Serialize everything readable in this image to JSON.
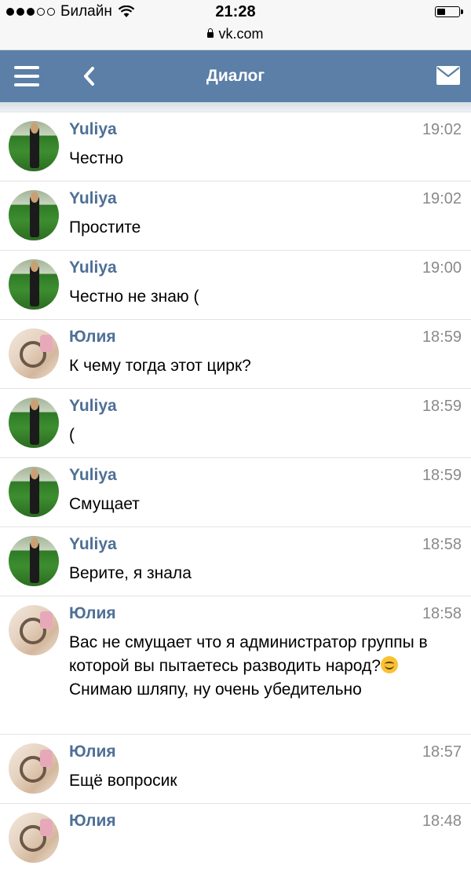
{
  "status_bar": {
    "carrier": "Билайн",
    "time": "21:28",
    "url": "vk.com",
    "battery_level": 0.4
  },
  "header": {
    "title": "Диалог",
    "menu_icon": "hamburger-icon",
    "back_icon": "chevron-left-icon",
    "mail_icon": "envelope-icon"
  },
  "colors": {
    "header_bg": "#5b7fa6",
    "name_color": "#4e6f96"
  },
  "messages": [
    {
      "author": "Yuliya",
      "avatar": "yuliya",
      "time": "19:02",
      "text": "Честно"
    },
    {
      "author": "Yuliya",
      "avatar": "yuliya",
      "time": "19:02",
      "text": "Простите"
    },
    {
      "author": "Yuliya",
      "avatar": "yuliya",
      "time": "19:00",
      "text": "Честно не знаю ("
    },
    {
      "author": "Юлия",
      "avatar": "yulia",
      "time": "18:59",
      "text": "К чему тогда этот цирк?"
    },
    {
      "author": "Yuliya",
      "avatar": "yuliya",
      "time": "18:59",
      "text": "("
    },
    {
      "author": "Yuliya",
      "avatar": "yuliya",
      "time": "18:59",
      "text": "Смущает"
    },
    {
      "author": "Yuliya",
      "avatar": "yuliya",
      "time": "18:58",
      "text": "Верите, я знала"
    },
    {
      "author": "Юлия",
      "avatar": "yulia",
      "time": "18:58",
      "text": "Вас не смущает что я администратор группы в которой вы пытаетесь разводить народ?",
      "emoji": "smiling-face-emoji",
      "text_after": " Снимаю шляпу, ну очень убедительно"
    },
    {
      "author": "Юлия",
      "avatar": "yulia",
      "time": "18:57",
      "text": "Ещё вопросик"
    },
    {
      "author": "Юлия",
      "avatar": "yulia",
      "time": "18:48",
      "text": ""
    }
  ]
}
